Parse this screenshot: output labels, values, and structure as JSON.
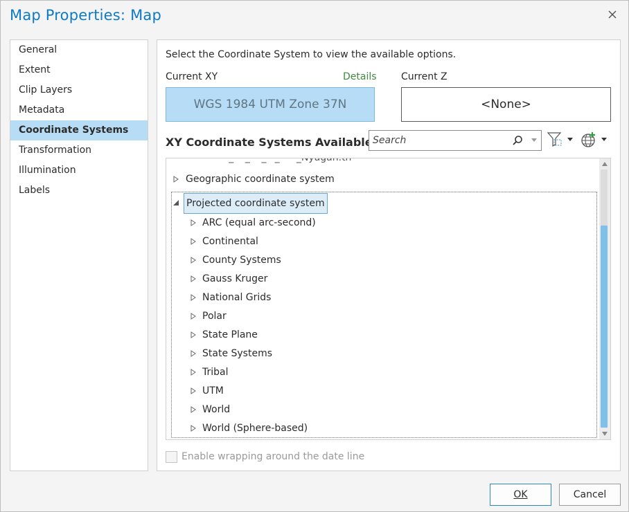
{
  "dialog": {
    "title": "Map Properties: Map"
  },
  "sidebar": {
    "items": [
      {
        "label": "General"
      },
      {
        "label": "Extent"
      },
      {
        "label": "Clip Layers"
      },
      {
        "label": "Metadata"
      },
      {
        "label": "Coordinate Systems",
        "active": true
      },
      {
        "label": "Transformation"
      },
      {
        "label": "Illumination"
      },
      {
        "label": "Labels"
      }
    ]
  },
  "main": {
    "instruction": "Select the Coordinate System to view the available options.",
    "current_xy_label": "Current XY",
    "details_link": "Details",
    "current_xy_value": "WGS 1984 UTM Zone 37N",
    "current_z_label": "Current Z",
    "current_z_value": "<None>",
    "available_heading": "XY Coordinate Systems Available",
    "search": {
      "placeholder": "Search",
      "value": ""
    },
    "tree": {
      "clipped_item": "– '_ ' '_ ' '_' '_' '' '_Nyagan.th",
      "geographic": "Geographic coordinate system",
      "projected": "Projected coordinate system",
      "children": [
        "ARC (equal arc-second)",
        "Continental",
        "County Systems",
        "Gauss Kruger",
        "National Grids",
        "Polar",
        "State Plane",
        "State Systems",
        "Tribal",
        "UTM",
        "World",
        "World (Sphere-based)"
      ]
    },
    "wrap_label": "Enable wrapping around the date line"
  },
  "footer": {
    "ok_label": "OK",
    "cancel_label": "Cancel"
  },
  "colors": {
    "accent": "#0e7ac4",
    "selection": "#b7dcf5",
    "details": "#3d8b3d",
    "scroll_thumb": "#7fc0ea"
  }
}
